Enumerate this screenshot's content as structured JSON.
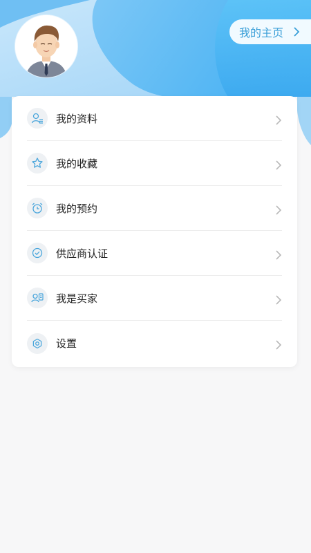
{
  "header": {
    "home_label": "我的主页",
    "accent_color": "#5ab4f2"
  },
  "menu": {
    "items": [
      {
        "label": "我的资料",
        "icon": "user-profile-icon"
      },
      {
        "label": "我的收藏",
        "icon": "star-icon"
      },
      {
        "label": "我的预约",
        "icon": "alarm-clock-icon"
      },
      {
        "label": "供应商认证",
        "icon": "verified-badge-icon"
      },
      {
        "label": "我是买家",
        "icon": "buyer-card-icon"
      },
      {
        "label": "设置",
        "icon": "settings-gear-icon"
      }
    ]
  }
}
